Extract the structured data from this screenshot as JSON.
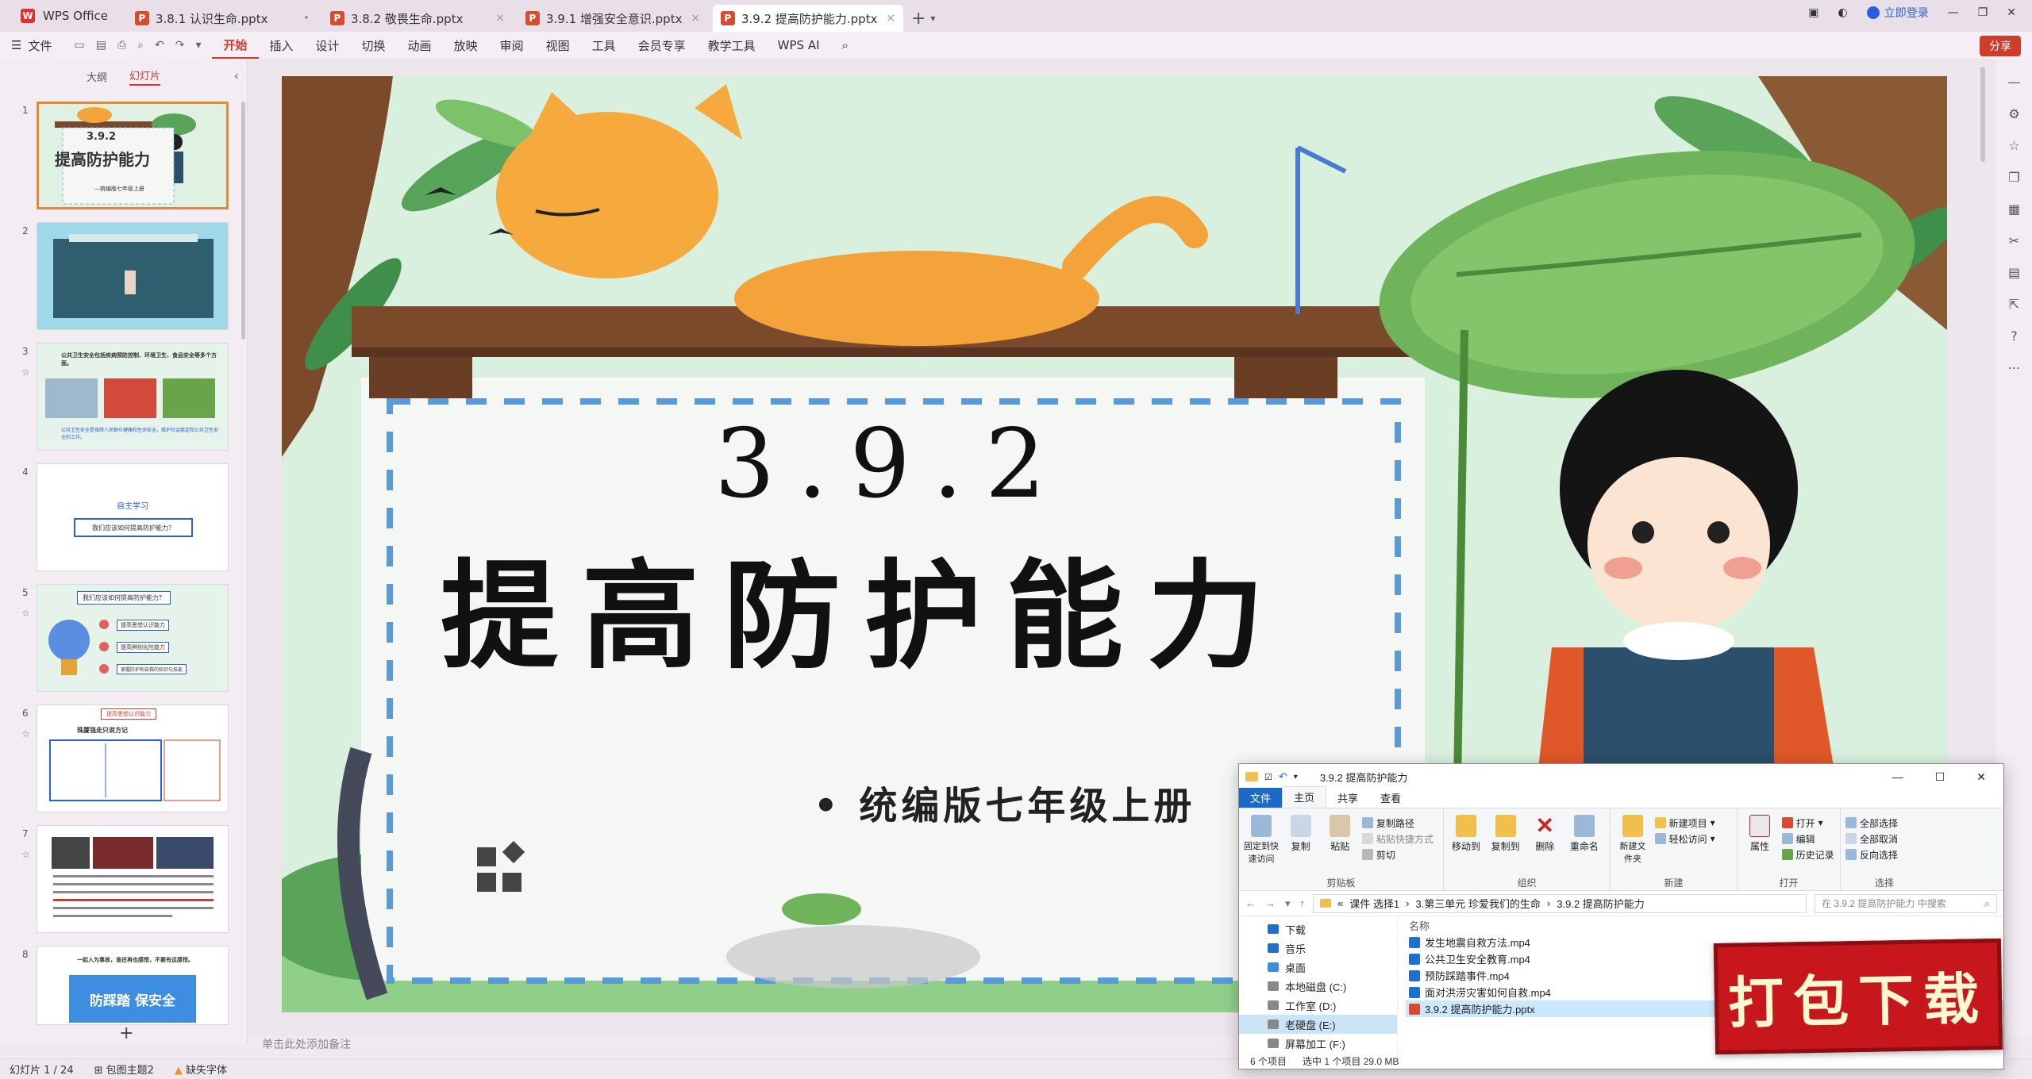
{
  "tabbar": {
    "app_label": "WPS Office",
    "tabs": [
      {
        "label": "3.8.1 认识生命.pptx",
        "active": false
      },
      {
        "label": "3.8.2 敬畏生命.pptx",
        "active": false
      },
      {
        "label": "3.9.1 增强安全意识.pptx",
        "active": false
      },
      {
        "label": "3.9.2 提高防护能力.pptx",
        "active": true
      }
    ],
    "login_label": "立即登录"
  },
  "ribbon": {
    "file_label": "文件",
    "tabs": [
      "开始",
      "插入",
      "设计",
      "切换",
      "动画",
      "放映",
      "审阅",
      "视图",
      "工具",
      "会员专享",
      "教学工具",
      "WPS AI"
    ],
    "active_tab": "开始",
    "share_label": "分享"
  },
  "left_panel": {
    "tab_outline": "大纲",
    "tab_slides": "幻灯片",
    "thumbs": {
      "s1_num": "3.9.2",
      "s1_title": "提高防护能力",
      "s1_sub": "—统编版七年级上册",
      "s3_text": "公共卫生安全包括疾病预防控制、环境卫生、食品安全等多个方面。",
      "s3_foot": "公共卫生安全是保障人民群众健康和生命安全，维护社会稳定和公共卫生安全的工作。",
      "s4_title": "自主学习",
      "s4_box": "我们应该如何提高防护能力？",
      "s5_title": "我们应该如何提高防护能力？",
      "s5_items": [
        "提高思想认识能力",
        "提高辨别化险能力",
        "掌握防护和自救的知识与技能"
      ],
      "s6_head": "提高思想认识能力",
      "s6_sub": "珠厦强走只说方记",
      "s8_title": "防踩踏 保安全",
      "s8_top": "一起入为事故，谁还再也感悟，不要有这感悟。"
    },
    "slide_numbers": [
      "1",
      "2",
      "3",
      "4",
      "5",
      "6",
      "7",
      "8"
    ]
  },
  "slide": {
    "number": "3.9.2",
    "title": "提高防护能力",
    "subtitle": "• 统编版七年级上册"
  },
  "notes_placeholder": "单击此处添加备注",
  "status": {
    "slide_counter": "幻灯片 1 / 24",
    "theme": "包图主题2",
    "missing_font": "缺失字体"
  },
  "explorer": {
    "title": "3.9.2 提高防护能力",
    "tabs": [
      "文件",
      "主页",
      "共享",
      "查看"
    ],
    "ribbon_groups": {
      "clipboard": {
        "name": "剪贴板",
        "pin": "固定到快速访问",
        "copy": "复制",
        "paste": "粘贴",
        "copy_path": "复制路径",
        "paste_shortcut": "粘贴快捷方式",
        "cut": "剪切"
      },
      "organize": {
        "name": "组织",
        "move_to": "移动到",
        "copy_to": "复制到",
        "delete": "删除",
        "rename": "重命名"
      },
      "new": {
        "name": "新建",
        "new_folder": "新建文件夹",
        "new_item": "新建项目",
        "easy_access": "轻松访问"
      },
      "open": {
        "name": "打开",
        "properties": "属性",
        "open": "打开",
        "edit": "编辑",
        "history": "历史记录"
      },
      "select": {
        "name": "选择",
        "select_all": "全部选择",
        "select_none": "全部取消",
        "invert": "反向选择"
      }
    },
    "path": [
      "课件 选择1",
      "3.第三单元 珍爱我们的生命",
      "3.9.2 提高防护能力"
    ],
    "search_placeholder": "在 3.9.2 提高防护能力 中搜索",
    "nav_items": [
      "下载",
      "音乐",
      "桌面",
      "本地磁盘 (C:)",
      "工作室 (D:)",
      "老硬盘 (E:)",
      "屏幕加工 (F:)"
    ],
    "nav_selected": "老硬盘 (E:)",
    "col_name": "名称",
    "files": [
      "发生地震自救方法.mp4",
      "公共卫生安全教育.mp4",
      "预防踩踏事件.mp4",
      "面对洪涝灾害如何自救.mp4",
      "3.9.2 提高防护能力.pptx"
    ],
    "selected_file": "3.9.2 提高防护能力.pptx",
    "status_count": "6 个项目",
    "status_selected": "选中 1 个项目  29.0 MB"
  },
  "badge": {
    "label": "打包下载"
  },
  "colors": {
    "accent": "#d13b2c",
    "explorer_blue": "#1b6ac9",
    "badge_red": "#c8161d"
  }
}
